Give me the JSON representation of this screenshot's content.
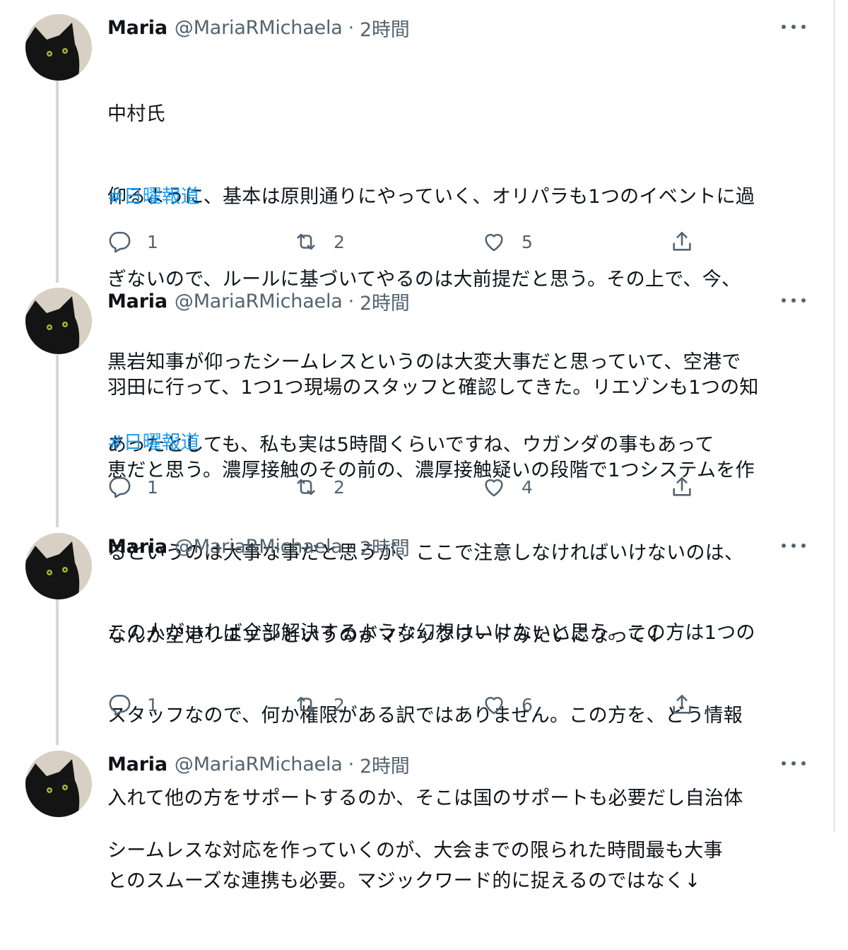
{
  "tweets": [
    {
      "name": "Maria",
      "handle": "@MariaRMichaela",
      "separator": "·",
      "time": "2時間",
      "text_lines": [
        "中村氏",
        "仰るように、基本は原則通りにやっていく、オリパラも1つのイベントに過",
        "ぎないので、ルールに基づいてやるのは大前提だと思う。その上で、今、",
        "黒岩知事が仰ったシームレスというのは大変大事だと思っていて、空港で",
        "あったとしても、私も実は5時間くらいですね、ウガンダの事もあって"
      ],
      "hashtag": "#日曜報道",
      "reply_count": "1",
      "retweet_count": "2",
      "like_count": "5"
    },
    {
      "name": "Maria",
      "handle": "@MariaRMichaela",
      "separator": "·",
      "time": "2時間",
      "text_lines": [
        "羽田に行って、1つ1つ現場のスタッフと確認してきた。リエゾンも1つの知",
        "恵だと思う。濃厚接触のその前の、濃厚接触疑いの段階で1つシステムを作",
        "るというのは大事な事だと思うが、ここで注意しなければいけないのは、",
        "なんか空港リエゾンというのがマジックワードみたいになって↓"
      ],
      "hashtag": "#日曜報道",
      "reply_count": "1",
      "retweet_count": "2",
      "like_count": "4"
    },
    {
      "name": "Maria",
      "handle": "@MariaRMichaela",
      "separator": "·",
      "time": "2時間",
      "text_lines": [
        "この人がいれば全部解決するような幻想はいけないと思う。この方は1つの",
        "スタッフなので、何か権限がある訳ではありません。この方を、どう情報",
        "入れて他の方をサポートするのか、そこは国のサポートも必要だし自治体",
        "とのスムーズな連携も必要。マジックワード的に捉えるのではなく↓"
      ],
      "hashtag": "",
      "reply_count": "1",
      "retweet_count": "2",
      "like_count": "6"
    },
    {
      "name": "Maria",
      "handle": "@MariaRMichaela",
      "separator": "·",
      "time": "2時間",
      "text_lines": [
        "シームレスな対応を作っていくのが、大会までの限られた時間最も大事"
      ],
      "hashtag": "",
      "reply_count": "",
      "retweet_count": "",
      "like_count": ""
    }
  ],
  "icons": {
    "avatar": "black-cat-avatar",
    "more": "more-horizontal-icon",
    "reply": "reply-icon",
    "retweet": "retweet-icon",
    "like": "heart-icon",
    "share": "share-icon"
  },
  "colors": {
    "text": "#0f1419",
    "secondary": "#536471",
    "hashtag": "#1d9bf0",
    "thread_line": "#cfd9de"
  }
}
